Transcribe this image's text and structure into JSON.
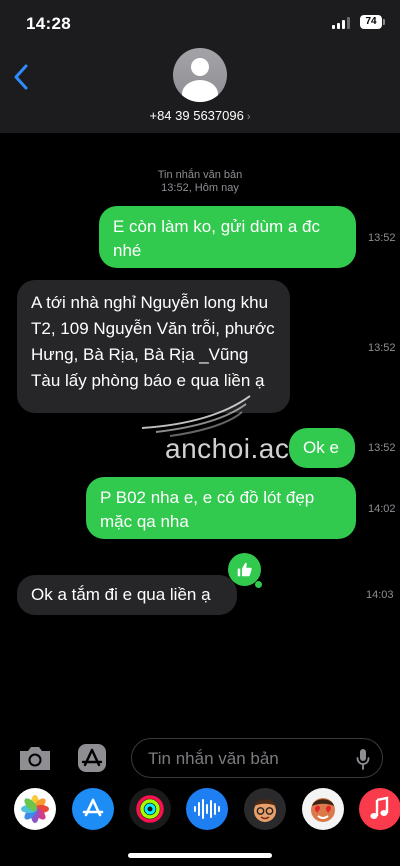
{
  "status": {
    "time": "14:28",
    "battery": "74"
  },
  "header": {
    "phone": "+84 39 5637096",
    "chevron": "›"
  },
  "conversation": {
    "label": "Tin nhắn văn bản",
    "datetime": "13:52, Hôm nay",
    "watermark": "anchoi.ac",
    "messages": [
      {
        "type": "sent",
        "text": "E còn làm ko, gửi dùm a đc nhé",
        "time": "13:52"
      },
      {
        "type": "received",
        "text": "A tới nhà nghỉ Nguyễn long khu T2, 109 Nguyễn Văn trỗi, phước Hưng, Bà Rịa, Bà Rịa _Vũng Tàu lấy phòng báo e qua liền ạ",
        "time": "13:52"
      },
      {
        "type": "sent",
        "text": "Ok e",
        "time": "13:52"
      },
      {
        "type": "sent",
        "text": "P B02 nha e, e có đồ lót đẹp mặc qa nha",
        "time": "14:02"
      },
      {
        "type": "received",
        "text": "Ok a tắm đi e qua liền ạ",
        "time": "14:03"
      }
    ]
  },
  "input": {
    "placeholder": "Tin nhắn văn bản"
  },
  "apps": [
    "photos",
    "app-store",
    "activity",
    "audio-message",
    "memoji",
    "memoji-stickers",
    "music"
  ],
  "colors": {
    "sent": "#31c94e",
    "received": "#262628",
    "accent": "#2f8cff",
    "background": "#000000"
  }
}
